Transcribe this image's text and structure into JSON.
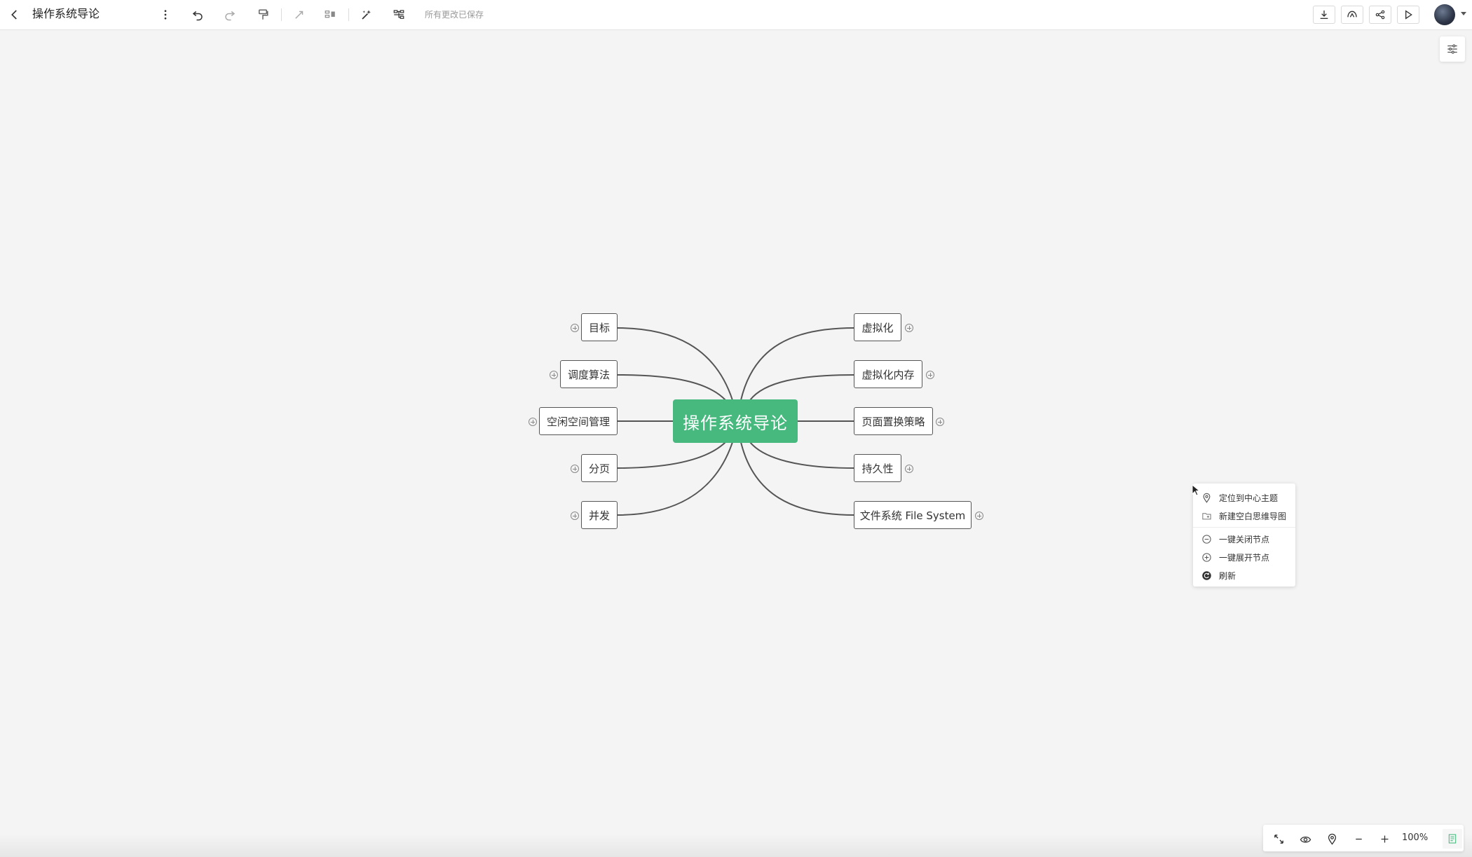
{
  "header": {
    "title": "操作系统导论",
    "save_status": "所有更改已保存"
  },
  "mindmap": {
    "root": "操作系统导论",
    "left_children": [
      "目标",
      "调度算法",
      "空闲空间管理",
      "分页",
      "并发"
    ],
    "right_children": [
      "虚拟化",
      "虚拟化内存",
      "页面置换策略",
      "持久性",
      "文件系统 File System"
    ]
  },
  "context_menu": {
    "items": [
      "定位到中心主题",
      "新建空白思维导图",
      "一键关闭节点",
      "一键展开节点",
      "刷新"
    ]
  },
  "zoom": {
    "level": "100%"
  },
  "colors": {
    "root_bg": "#47b97f",
    "canvas_bg": "#f4f4f4",
    "link": "#555555"
  }
}
